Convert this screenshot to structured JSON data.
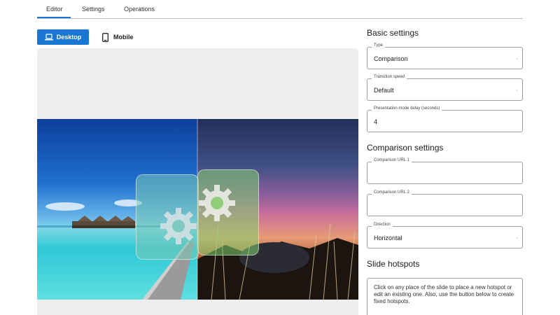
{
  "tabs": [
    {
      "label": "Editor",
      "active": true
    },
    {
      "label": "Settings",
      "active": false
    },
    {
      "label": "Operations",
      "active": false
    }
  ],
  "device_toggle": {
    "desktop_label": "Desktop",
    "mobile_label": "Mobile",
    "desktop_icon": "laptop-icon",
    "mobile_icon": "phone-icon",
    "selected": "Desktop"
  },
  "colors": {
    "accent": "#1976d2",
    "preview_bg": "#eeeeee",
    "border": "#9e9e9e"
  },
  "preview": {
    "overlay_icon": "gear-icon",
    "handle_icon": "chevron-right-icon"
  },
  "basic_settings": {
    "title": "Basic settings",
    "type": {
      "label": "Type",
      "value": "Comparison"
    },
    "transition_speed": {
      "label": "Transition speed",
      "value": "Default"
    },
    "presentation_delay": {
      "label": "Presentation mode delay (seconds)",
      "value": "4"
    }
  },
  "comparison_settings": {
    "title": "Comparison settings",
    "url1": {
      "label": "Comparison URL 1",
      "value": ""
    },
    "url2": {
      "label": "Comparison URL 2",
      "value": ""
    },
    "direction": {
      "label": "Direction",
      "value": "Horizontal"
    }
  },
  "slide_hotspots": {
    "title": "Slide hotspots",
    "help_text": "Click on any place of the slide to place a new hotspot or edit an existing one. Also, use the button below to create fixed hotspots."
  }
}
